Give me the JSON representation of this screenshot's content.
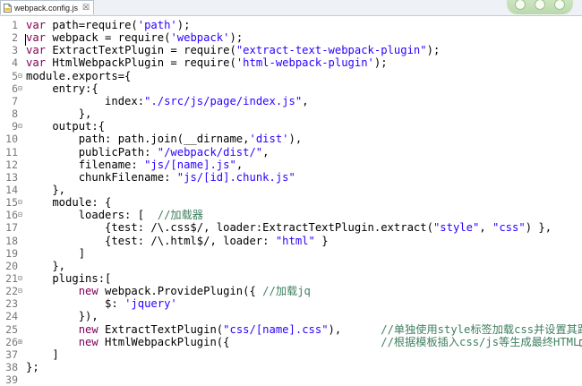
{
  "tab": {
    "label": "webpack.config.js",
    "close_glyph": "☒"
  },
  "lines": [
    {
      "n": "1",
      "fold": "",
      "parts": [
        {
          "t": "var",
          "c": "kw"
        },
        {
          "t": " path=require("
        },
        {
          "t": "'path'",
          "c": "str"
        },
        {
          "t": ");"
        }
      ]
    },
    {
      "n": "2",
      "fold": "",
      "parts": [
        {
          "t": "var",
          "c": "kw"
        },
        {
          "t": " webpack = require("
        },
        {
          "t": "'webpack'",
          "c": "str"
        },
        {
          "t": ");"
        }
      ]
    },
    {
      "n": "3",
      "fold": "",
      "parts": [
        {
          "t": "var",
          "c": "kw"
        },
        {
          "t": " ExtractTextPlugin = require("
        },
        {
          "t": "\"extract-text-webpack-plugin\"",
          "c": "str"
        },
        {
          "t": ");"
        }
      ]
    },
    {
      "n": "4",
      "fold": "",
      "parts": [
        {
          "t": "var",
          "c": "kw"
        },
        {
          "t": " HtmlWebpackPlugin = require("
        },
        {
          "t": "'html-webpack-plugin'",
          "c": "str"
        },
        {
          "t": ");"
        }
      ]
    },
    {
      "n": "5",
      "fold": "⊟",
      "parts": [
        {
          "t": "module.exports={"
        }
      ]
    },
    {
      "n": "6",
      "fold": "⊟",
      "parts": [
        {
          "t": "    entry:{"
        }
      ]
    },
    {
      "n": "7",
      "fold": "",
      "parts": [
        {
          "t": "            index:"
        },
        {
          "t": "\"./src/js/page/index.js\"",
          "c": "str"
        },
        {
          "t": ","
        }
      ]
    },
    {
      "n": "8",
      "fold": "",
      "parts": [
        {
          "t": "        },"
        }
      ]
    },
    {
      "n": "9",
      "fold": "⊟",
      "parts": [
        {
          "t": "    output:{"
        }
      ]
    },
    {
      "n": "10",
      "fold": "",
      "parts": [
        {
          "t": "        path: path.join(__dirname,"
        },
        {
          "t": "'dist'",
          "c": "str"
        },
        {
          "t": "),"
        }
      ]
    },
    {
      "n": "11",
      "fold": "",
      "parts": [
        {
          "t": "        publicPath: "
        },
        {
          "t": "\"/webpack/dist/\"",
          "c": "str"
        },
        {
          "t": ","
        }
      ]
    },
    {
      "n": "12",
      "fold": "",
      "parts": [
        {
          "t": "        filename: "
        },
        {
          "t": "\"js/[name].js\"",
          "c": "str"
        },
        {
          "t": ","
        }
      ]
    },
    {
      "n": "13",
      "fold": "",
      "parts": [
        {
          "t": "        chunkFilename: "
        },
        {
          "t": "\"js/[id].chunk.js\"",
          "c": "str"
        }
      ]
    },
    {
      "n": "14",
      "fold": "",
      "parts": [
        {
          "t": "    },"
        }
      ]
    },
    {
      "n": "15",
      "fold": "⊟",
      "parts": [
        {
          "t": "    module: {"
        }
      ]
    },
    {
      "n": "16",
      "fold": "⊟",
      "parts": [
        {
          "t": "        loaders: [  "
        },
        {
          "t": "//加载器",
          "c": "cm"
        }
      ]
    },
    {
      "n": "17",
      "fold": "",
      "parts": [
        {
          "t": "            {test: /\\.css$/, loader:ExtractTextPlugin.extract("
        },
        {
          "t": "\"style\"",
          "c": "str"
        },
        {
          "t": ", "
        },
        {
          "t": "\"css\"",
          "c": "str"
        },
        {
          "t": ") },"
        }
      ]
    },
    {
      "n": "18",
      "fold": "",
      "parts": [
        {
          "t": "            {test: /\\.html$/, loader: "
        },
        {
          "t": "\"html\"",
          "c": "str"
        },
        {
          "t": " }"
        }
      ]
    },
    {
      "n": "19",
      "fold": "",
      "parts": [
        {
          "t": "        ]"
        }
      ]
    },
    {
      "n": "20",
      "fold": "",
      "parts": [
        {
          "t": "    },"
        }
      ]
    },
    {
      "n": "21",
      "fold": "⊟",
      "parts": [
        {
          "t": "    plugins:["
        }
      ]
    },
    {
      "n": "22",
      "fold": "⊟",
      "parts": [
        {
          "t": "        "
        },
        {
          "t": "new",
          "c": "kw"
        },
        {
          "t": " webpack.ProvidePlugin({ "
        },
        {
          "t": "//加载jq",
          "c": "cm"
        }
      ]
    },
    {
      "n": "23",
      "fold": "",
      "parts": [
        {
          "t": "            $: "
        },
        {
          "t": "'jquery'",
          "c": "str"
        }
      ]
    },
    {
      "n": "24",
      "fold": "",
      "parts": [
        {
          "t": "        }),"
        }
      ]
    },
    {
      "n": "25",
      "fold": "",
      "parts": [
        {
          "t": "        "
        },
        {
          "t": "new",
          "c": "kw"
        },
        {
          "t": " ExtractTextPlugin("
        },
        {
          "t": "\"css/[name].css\"",
          "c": "str"
        },
        {
          "t": "),      "
        },
        {
          "t": "//单独使用style标签加载css并设置其路径",
          "c": "cm"
        }
      ]
    },
    {
      "n": "26",
      "fold": "⊞",
      "parts": [
        {
          "t": "        "
        },
        {
          "t": "new",
          "c": "kw"
        },
        {
          "t": " HtmlWebpackPlugin({                       "
        },
        {
          "t": "//根据模板插入css/js等生成最终HTML",
          "c": "cm"
        },
        {
          "t": "□"
        }
      ]
    },
    {
      "n": "37",
      "fold": "",
      "parts": [
        {
          "t": "    ]"
        }
      ]
    },
    {
      "n": "38",
      "fold": "",
      "parts": [
        {
          "t": "};"
        }
      ]
    },
    {
      "n": "39",
      "fold": "",
      "parts": []
    }
  ]
}
